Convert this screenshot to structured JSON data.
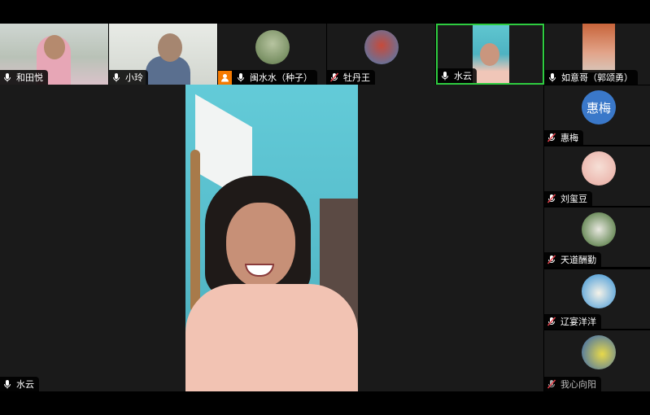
{
  "participants_top": [
    {
      "name": "和田悦",
      "muted": false
    },
    {
      "name": "小玲",
      "muted": false
    },
    {
      "name": "闽水水（种子）",
      "muted": false,
      "host": true
    },
    {
      "name": "牡丹王",
      "muted": true
    },
    {
      "name": "水云",
      "muted": false,
      "active": true
    },
    {
      "name": "如意哥（郭颂勇）",
      "muted": false
    }
  ],
  "main_speaker": {
    "name": "水云",
    "muted": false
  },
  "sidebar": [
    {
      "name": "惠梅",
      "avatar_text": "惠梅",
      "muted": true
    },
    {
      "name": "刘玺豆",
      "muted": true
    },
    {
      "name": "天道酬勤",
      "muted": true
    },
    {
      "name": "辽宴洋洋",
      "muted": true
    },
    {
      "name": "我心向阳",
      "muted": true
    }
  ],
  "colors": {
    "active_border": "#2ecc40",
    "avatar_blue": "#3a78c9",
    "host_badge": "#f57a00",
    "muted_mic": "#e0404a"
  }
}
